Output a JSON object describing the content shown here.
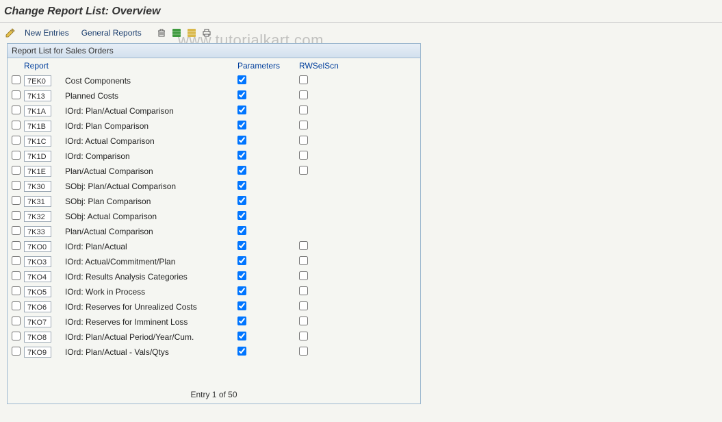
{
  "title": "Change Report List: Overview",
  "toolbar": {
    "new_entries": "New Entries",
    "general_reports": "General Reports"
  },
  "watermark": "www.tutorialkart.com",
  "panel": {
    "header": "Report List for Sales Orders",
    "columns": {
      "report": "Report",
      "parameters": "Parameters",
      "rwselscn": "RWSelScn"
    },
    "footer": "Entry 1 of 50"
  },
  "rows": [
    {
      "code": "7EK0",
      "desc": "Cost Components",
      "parameters": true,
      "rwselscn": false,
      "rw_visible": true
    },
    {
      "code": "7K13",
      "desc": "Planned Costs",
      "parameters": true,
      "rwselscn": false,
      "rw_visible": true
    },
    {
      "code": "7K1A",
      "desc": "IOrd: Plan/Actual Comparison",
      "parameters": true,
      "rwselscn": false,
      "rw_visible": true
    },
    {
      "code": "7K1B",
      "desc": "IOrd: Plan Comparison",
      "parameters": true,
      "rwselscn": false,
      "rw_visible": true
    },
    {
      "code": "7K1C",
      "desc": "IOrd: Actual Comparison",
      "parameters": true,
      "rwselscn": false,
      "rw_visible": true
    },
    {
      "code": "7K1D",
      "desc": "IOrd: Comparison",
      "parameters": true,
      "rwselscn": false,
      "rw_visible": true
    },
    {
      "code": "7K1E",
      "desc": "Plan/Actual Comparison",
      "parameters": true,
      "rwselscn": false,
      "rw_visible": true
    },
    {
      "code": "7K30",
      "desc": "SObj: Plan/Actual Comparison",
      "parameters": true,
      "rwselscn": false,
      "rw_visible": false
    },
    {
      "code": "7K31",
      "desc": "SObj: Plan Comparison",
      "parameters": true,
      "rwselscn": false,
      "rw_visible": false
    },
    {
      "code": "7K32",
      "desc": "SObj: Actual Comparison",
      "parameters": true,
      "rwselscn": false,
      "rw_visible": false
    },
    {
      "code": "7K33",
      "desc": "Plan/Actual Comparison",
      "parameters": true,
      "rwselscn": false,
      "rw_visible": false
    },
    {
      "code": "7KO0",
      "desc": "IOrd: Plan/Actual",
      "parameters": true,
      "rwselscn": false,
      "rw_visible": true
    },
    {
      "code": "7KO3",
      "desc": "IOrd: Actual/Commitment/Plan",
      "parameters": true,
      "rwselscn": false,
      "rw_visible": true
    },
    {
      "code": "7KO4",
      "desc": "IOrd: Results Analysis Categories",
      "parameters": true,
      "rwselscn": false,
      "rw_visible": true
    },
    {
      "code": "7KO5",
      "desc": "IOrd: Work in Process",
      "parameters": true,
      "rwselscn": false,
      "rw_visible": true
    },
    {
      "code": "7KO6",
      "desc": "IOrd: Reserves for Unrealized Costs",
      "parameters": true,
      "rwselscn": false,
      "rw_visible": true
    },
    {
      "code": "7KO7",
      "desc": "IOrd: Reserves for Imminent Loss",
      "parameters": true,
      "rwselscn": false,
      "rw_visible": true
    },
    {
      "code": "7KO8",
      "desc": "IOrd: Plan/Actual Period/Year/Cum.",
      "parameters": true,
      "rwselscn": false,
      "rw_visible": true
    },
    {
      "code": "7KO9",
      "desc": "IOrd: Plan/Actual - Vals/Qtys",
      "parameters": true,
      "rwselscn": false,
      "rw_visible": true
    }
  ]
}
